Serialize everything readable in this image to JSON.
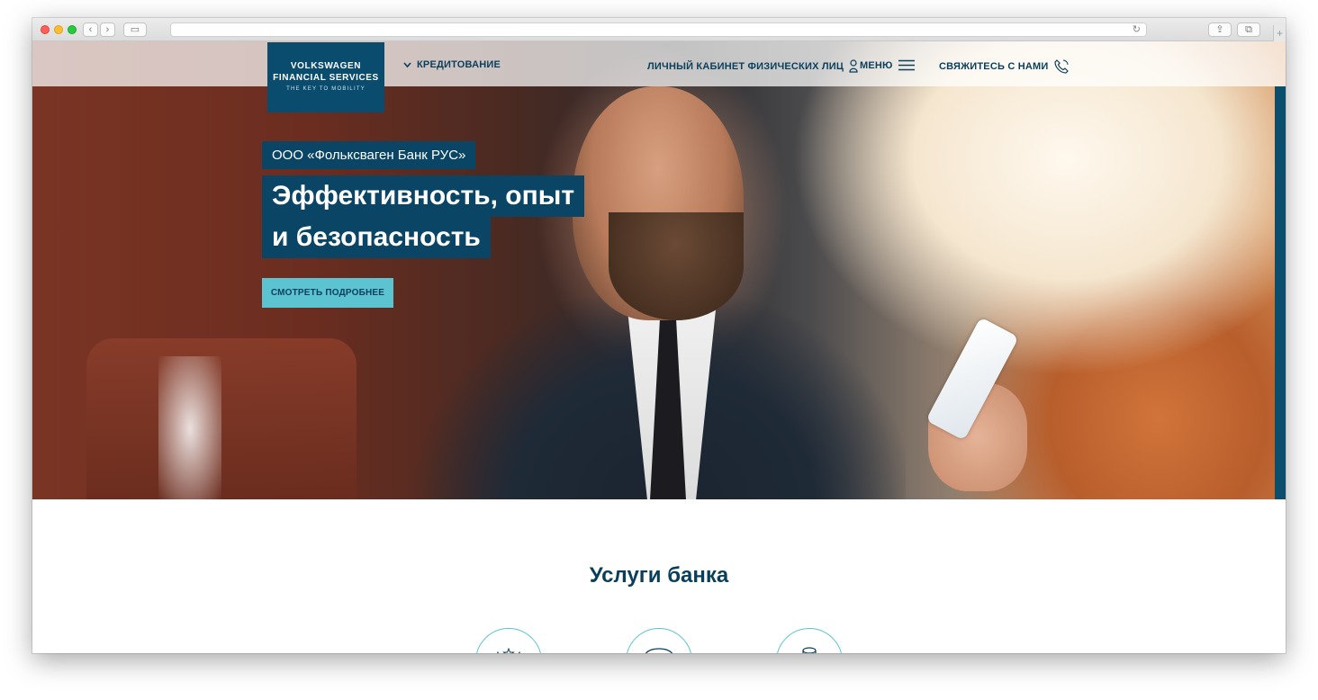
{
  "browser": {
    "address": "",
    "back_icon": "‹",
    "forward_icon": "›",
    "sidebar_icon": "▭",
    "reload_icon": "↻",
    "share_icon": "⇪",
    "tabs_icon": "⧉",
    "new_tab_icon": "+"
  },
  "logo": {
    "line1": "VOLKSWAGEN",
    "line2": "FINANCIAL SERVICES",
    "line3": "THE KEY TO MOBILITY"
  },
  "nav": {
    "credit": "КРЕДИТОВАНИЕ",
    "cabinet": "ЛИЧНЫЙ КАБИНЕТ ФИЗИЧЕСКИХ ЛИЦ",
    "menu": "МЕНЮ",
    "contact": "СВЯЖИТЕСЬ С НАМИ"
  },
  "hero": {
    "tag": "ООО «Фольксваген Банк РУС»",
    "headline_line1": "Эффективность, опыт",
    "headline_line2": "и безопасность",
    "cta": "СМОТРЕТЬ ПОДРОБНЕЕ"
  },
  "services": {
    "title": "Услуги банка"
  },
  "colors": {
    "brand_dark": "#0a4565",
    "accent": "#5bc4d0"
  }
}
